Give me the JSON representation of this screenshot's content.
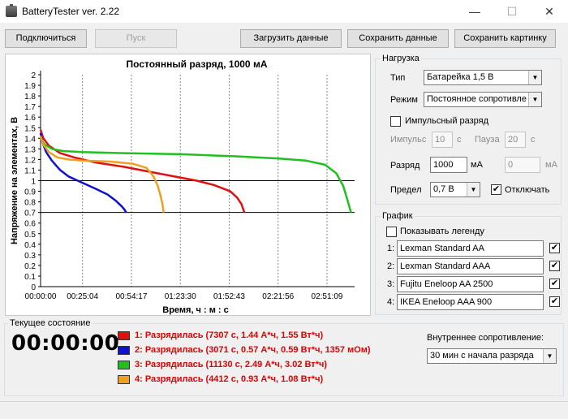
{
  "window": {
    "title": "BatteryTester ver. 2.22",
    "minimize": "—",
    "maximize": "☐",
    "close": "✕"
  },
  "toolbar": {
    "connect": "Подключиться",
    "start": "Пуск",
    "load": "Загрузить данные",
    "save_data": "Сохранить данные",
    "save_image": "Сохранить картинку"
  },
  "load_panel": {
    "title": "Нагрузка",
    "type_label": "Тип",
    "type_value": "Батарейка 1,5 В",
    "mode_label": "Режим",
    "mode_value": "Постоянное сопротивле",
    "pulse_label": "Импульсный разряд",
    "pulse_checked": false,
    "impulse_label": "Импульс",
    "impulse_value": "10",
    "impulse_unit": "с",
    "pause_label": "Пауза",
    "pause_value": "20",
    "pause_unit": "с",
    "discharge_label": "Разряд",
    "discharge_value": "1000",
    "discharge_unit": "мА",
    "discharge2_value": "0",
    "discharge2_unit": "мА",
    "limit_label": "Предел",
    "limit_value": "0,7 В",
    "cutoff_label": "Отключать",
    "cutoff_checked": true
  },
  "graph_panel": {
    "title": "График",
    "legend_label": "Показывать легенду",
    "legend_checked": false,
    "series": [
      {
        "index": "1:",
        "name": "Lexman Standard AA",
        "checked": true
      },
      {
        "index": "2:",
        "name": "Lexman Standard AAA",
        "checked": true
      },
      {
        "index": "3:",
        "name": "Fujitu Eneloop AA 2500",
        "checked": true
      },
      {
        "index": "4:",
        "name": "IKEA Eneloop AAA 900",
        "checked": true
      }
    ]
  },
  "status": {
    "title": "Текущее состояние",
    "timer": "00:00:00",
    "results": [
      {
        "color": "#e01010",
        "text": "1: Разрядилась (7307 с, 1.44 А*ч, 1.55 Вт*ч)"
      },
      {
        "color": "#1010d0",
        "text": "2: Разрядилась (3071 с, 0.57 А*ч, 0.59 Вт*ч, 1357 мОм)"
      },
      {
        "color": "#20c020",
        "text": "3: Разрядилась (11130 с, 2.49 А*ч, 3.02 Вт*ч)"
      },
      {
        "color": "#f0a020",
        "text": "4: Разрядилась (4412 с, 0.93 А*ч, 1.08 Вт*ч)"
      }
    ],
    "ir_label": "Внутреннее сопротивление:",
    "ir_value": "30 мин с начала разряда"
  },
  "chart_data": {
    "type": "line",
    "title": "Постоянный разряд, 1000 мА",
    "xlabel": "Время, ч : м : с",
    "ylabel": "Напряжение на элементах, В",
    "xlim": [
      0,
      11200
    ],
    "ylim": [
      0,
      2
    ],
    "x_ticks": [
      "00:00:00",
      "00:25:04",
      "00:54:17",
      "01:23:30",
      "01:52:43",
      "02:21:56",
      "02:51:09"
    ],
    "x_tick_values": [
      0,
      1504,
      3257,
      5010,
      6763,
      8516,
      10269
    ],
    "y_ticks": [
      "0",
      "0.1",
      "0.2",
      "0.3",
      "0.4",
      "0.5",
      "0.6",
      "0.7",
      "0.8",
      "0.9",
      "1",
      "1.1",
      "1.2",
      "1.3",
      "1.4",
      "1.5",
      "1.6",
      "1.7",
      "1.8",
      "1.9",
      "2"
    ],
    "hlines": [
      1.0,
      0.7
    ],
    "series": [
      {
        "color": "#e01010",
        "points": [
          [
            0,
            1.48
          ],
          [
            100,
            1.4
          ],
          [
            300,
            1.33
          ],
          [
            700,
            1.26
          ],
          [
            1200,
            1.22
          ],
          [
            2000,
            1.17
          ],
          [
            3000,
            1.13
          ],
          [
            4000,
            1.08
          ],
          [
            5000,
            1.03
          ],
          [
            5600,
            1.0
          ],
          [
            6200,
            0.96
          ],
          [
            6800,
            0.9
          ],
          [
            7050,
            0.84
          ],
          [
            7200,
            0.78
          ],
          [
            7307,
            0.7
          ]
        ]
      },
      {
        "color": "#1010d0",
        "points": [
          [
            0,
            1.45
          ],
          [
            80,
            1.35
          ],
          [
            200,
            1.27
          ],
          [
            400,
            1.19
          ],
          [
            700,
            1.1
          ],
          [
            1000,
            1.04
          ],
          [
            1500,
            0.98
          ],
          [
            2000,
            0.92
          ],
          [
            2400,
            0.87
          ],
          [
            2700,
            0.81
          ],
          [
            2900,
            0.76
          ],
          [
            3000,
            0.73
          ],
          [
            3071,
            0.7
          ]
        ]
      },
      {
        "color": "#20c020",
        "points": [
          [
            0,
            1.4
          ],
          [
            150,
            1.34
          ],
          [
            400,
            1.3
          ],
          [
            800,
            1.28
          ],
          [
            1500,
            1.27
          ],
          [
            3000,
            1.26
          ],
          [
            5000,
            1.25
          ],
          [
            7000,
            1.23
          ],
          [
            8500,
            1.21
          ],
          [
            9500,
            1.19
          ],
          [
            10200,
            1.15
          ],
          [
            10600,
            1.07
          ],
          [
            10850,
            0.95
          ],
          [
            11000,
            0.82
          ],
          [
            11130,
            0.7
          ]
        ]
      },
      {
        "color": "#f0a020",
        "points": [
          [
            0,
            1.42
          ],
          [
            100,
            1.34
          ],
          [
            300,
            1.27
          ],
          [
            600,
            1.22
          ],
          [
            1000,
            1.2
          ],
          [
            1500,
            1.19
          ],
          [
            2500,
            1.18
          ],
          [
            3300,
            1.16
          ],
          [
            3800,
            1.12
          ],
          [
            4050,
            1.04
          ],
          [
            4200,
            0.95
          ],
          [
            4300,
            0.86
          ],
          [
            4370,
            0.78
          ],
          [
            4412,
            0.7
          ]
        ]
      }
    ]
  }
}
